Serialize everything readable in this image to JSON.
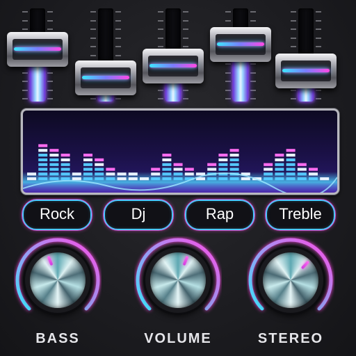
{
  "equalizer": {
    "bands": [
      {
        "level": 0.62
      },
      {
        "level": 0.2
      },
      {
        "level": 0.38
      },
      {
        "level": 0.7
      },
      {
        "level": 0.3
      }
    ],
    "accent_colors": [
      "#3ee6ff",
      "#7a3cff",
      "#ff49e6"
    ]
  },
  "visualizer": {
    "bar_levels": [
      2,
      8,
      7,
      6,
      2,
      6,
      5,
      3,
      2,
      2,
      1,
      3,
      6,
      4,
      3,
      2,
      4,
      6,
      7,
      2,
      1,
      4,
      6,
      7,
      4,
      3,
      1
    ]
  },
  "presets": {
    "items": [
      {
        "label": "Rock"
      },
      {
        "label": "Dj"
      },
      {
        "label": "Rap"
      },
      {
        "label": "Treble"
      }
    ]
  },
  "knobs": {
    "items": [
      {
        "label": "BASS",
        "level": 0.42
      },
      {
        "label": "VOLUME",
        "level": 0.58
      },
      {
        "label": "STEREO",
        "level": 0.66
      }
    ],
    "arc_colors": [
      "#3ee6ff",
      "#ff49e6"
    ]
  }
}
